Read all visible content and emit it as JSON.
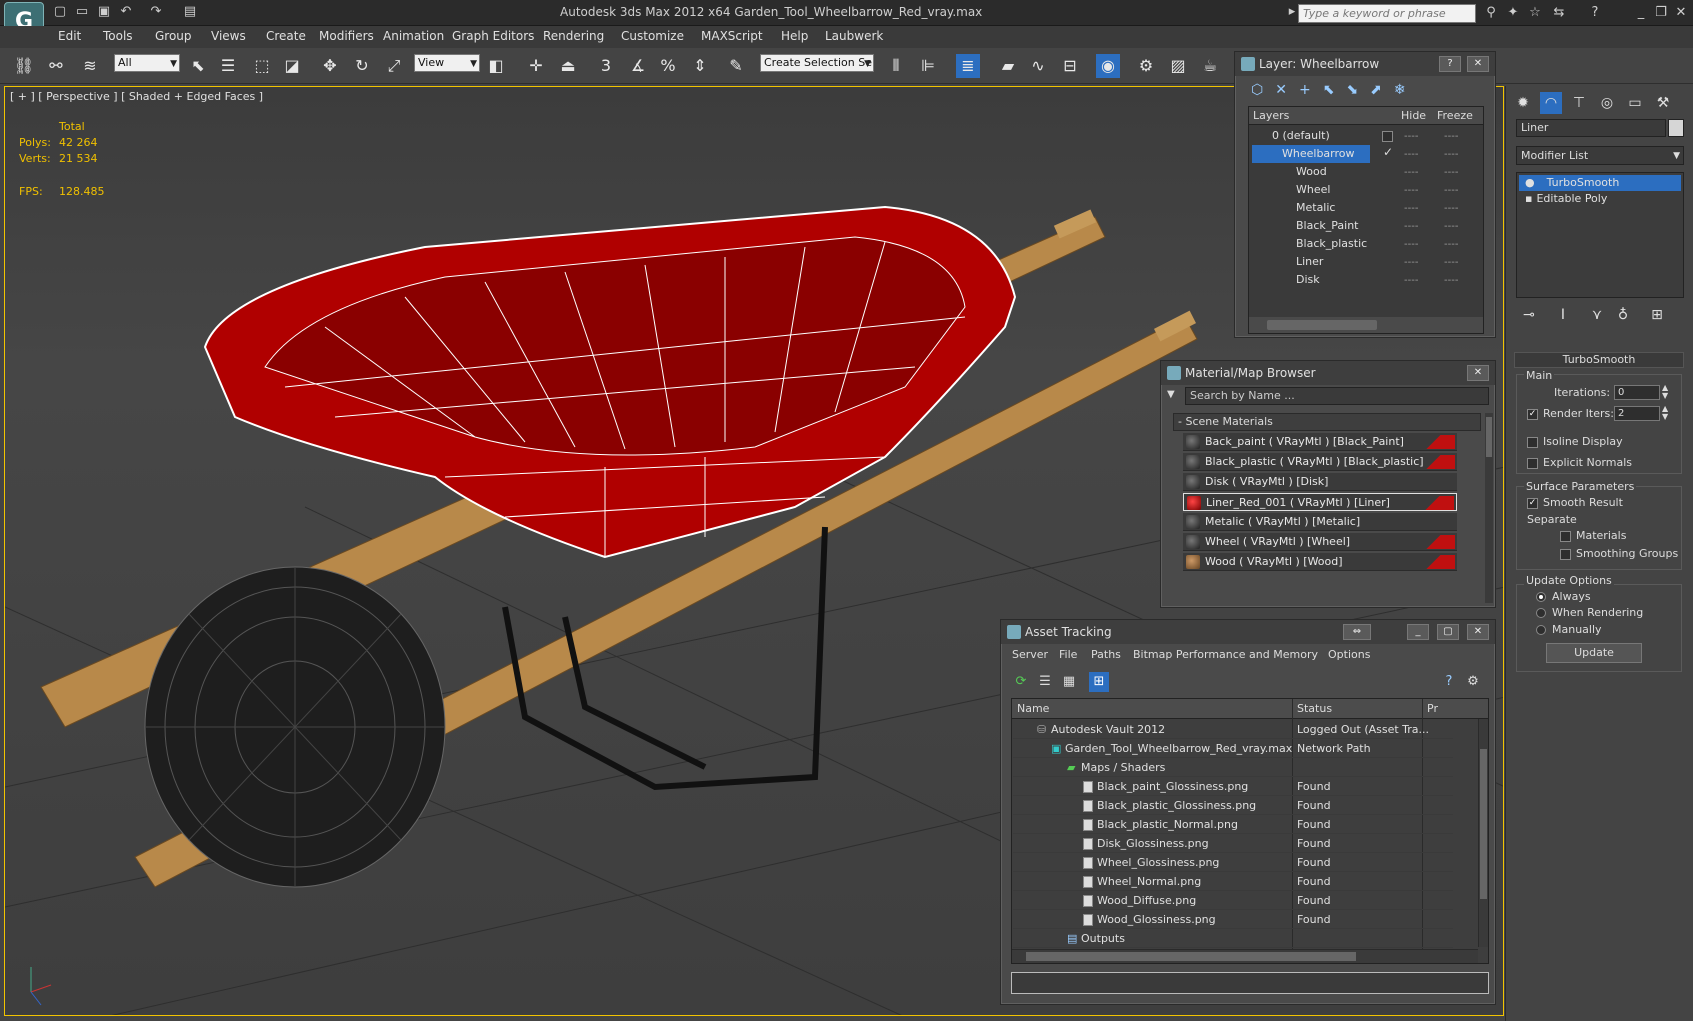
{
  "app": {
    "title": "Autodesk 3ds Max  2012 x64     Garden_Tool_Wheelbarrow_Red_vray.max",
    "logo": "G",
    "search_placeholder": "Type a keyword or phrase"
  },
  "menu": [
    "Edit",
    "Tools",
    "Group",
    "Views",
    "Create",
    "Modifiers",
    "Animation",
    "Graph Editors",
    "Rendering",
    "Customize",
    "MAXScript",
    "Help",
    "Laubwerk"
  ],
  "toolbar": {
    "filter_value": "All",
    "refcoord_value": "View",
    "selection_set_placeholder": "Create Selection Se",
    "snap_label": "3"
  },
  "viewport": {
    "label": "[ + ] [ Perspective ] [ Shaded + Edged Faces ]",
    "stats": {
      "total_label": "Total",
      "polys_label": "Polys:",
      "polys_value": "42 264",
      "verts_label": "Verts:",
      "verts_value": "21 534",
      "fps_label": "FPS:",
      "fps_value": "128.485"
    }
  },
  "command_panel": {
    "object_name": "Liner",
    "modifier_list": "Modifier List",
    "stack": [
      "TurboSmooth",
      "Editable Poly"
    ],
    "rollout_title": "TurboSmooth",
    "main_group": "Main",
    "iterations_label": "Iterations:",
    "iterations_value": "0",
    "render_iters_label": "Render Iters:",
    "render_iters_value": "2",
    "isoline_label": "Isoline Display",
    "explicit_normals_label": "Explicit Normals",
    "surface_group": "Surface Parameters",
    "smooth_result_label": "Smooth Result",
    "separate_label": "Separate",
    "materials_label": "Materials",
    "smoothing_groups_label": "Smoothing Groups",
    "update_group": "Update Options",
    "always_label": "Always",
    "when_rendering_label": "When Rendering",
    "manually_label": "Manually",
    "update_button": "Update"
  },
  "layer_window": {
    "title": "Layer: Wheelbarrow",
    "col_layers": "Layers",
    "col_hide": "Hide",
    "col_freeze": "Freeze",
    "rows": [
      "0 (default)",
      "Wheelbarrow",
      "Wood",
      "Wheel",
      "Metalic",
      "Black_Paint",
      "Black_plastic",
      "Liner",
      "Disk"
    ],
    "dash": "----"
  },
  "material_browser": {
    "title": "Material/Map Browser",
    "search_placeholder": "Search by Name ...",
    "section": "- Scene Materials",
    "materials": [
      "Back_paint  ( VRayMtl ) [Black_Paint]",
      "Black_plastic  ( VRayMtl ) [Black_plastic]",
      "Disk  ( VRayMtl ) [Disk]",
      "Liner_Red_001  ( VRayMtl ) [Liner]",
      "Metalic  ( VRayMtl ) [Metalic]",
      "Wheel  ( VRayMtl ) [Wheel]",
      "Wood  ( VRayMtl ) [Wood]"
    ]
  },
  "asset_tracking": {
    "title": "Asset Tracking",
    "menu": [
      "Server",
      "File",
      "Paths",
      "Bitmap Performance and Memory",
      "Options"
    ],
    "col_name": "Name",
    "col_status": "Status",
    "col_pr": "Pr",
    "rows": [
      {
        "name": "Autodesk Vault 2012",
        "status": "Logged Out (Asset Tra..."
      },
      {
        "name": "Garden_Tool_Wheelbarrow_Red_vray.max",
        "status": "Network Path"
      },
      {
        "name": "Maps / Shaders",
        "status": ""
      },
      {
        "name": "Black_paint_Glossiness.png",
        "status": "Found"
      },
      {
        "name": "Black_plastic_Glossiness.png",
        "status": "Found"
      },
      {
        "name": "Black_plastic_Normal.png",
        "status": "Found"
      },
      {
        "name": "Disk_Glossiness.png",
        "status": "Found"
      },
      {
        "name": "Wheel_Glossiness.png",
        "status": "Found"
      },
      {
        "name": "Wheel_Normal.png",
        "status": "Found"
      },
      {
        "name": "Wood_Diffuse.png",
        "status": "Found"
      },
      {
        "name": "Wood_Glossiness.png",
        "status": "Found"
      },
      {
        "name": "Outputs",
        "status": ""
      }
    ]
  },
  "colors": {
    "accent_selection": "#2c6ec0",
    "viewport_border": "#f2c400",
    "stats_text": "#f0c000",
    "liner_red": "#b00000",
    "wood": "#b8894a"
  }
}
